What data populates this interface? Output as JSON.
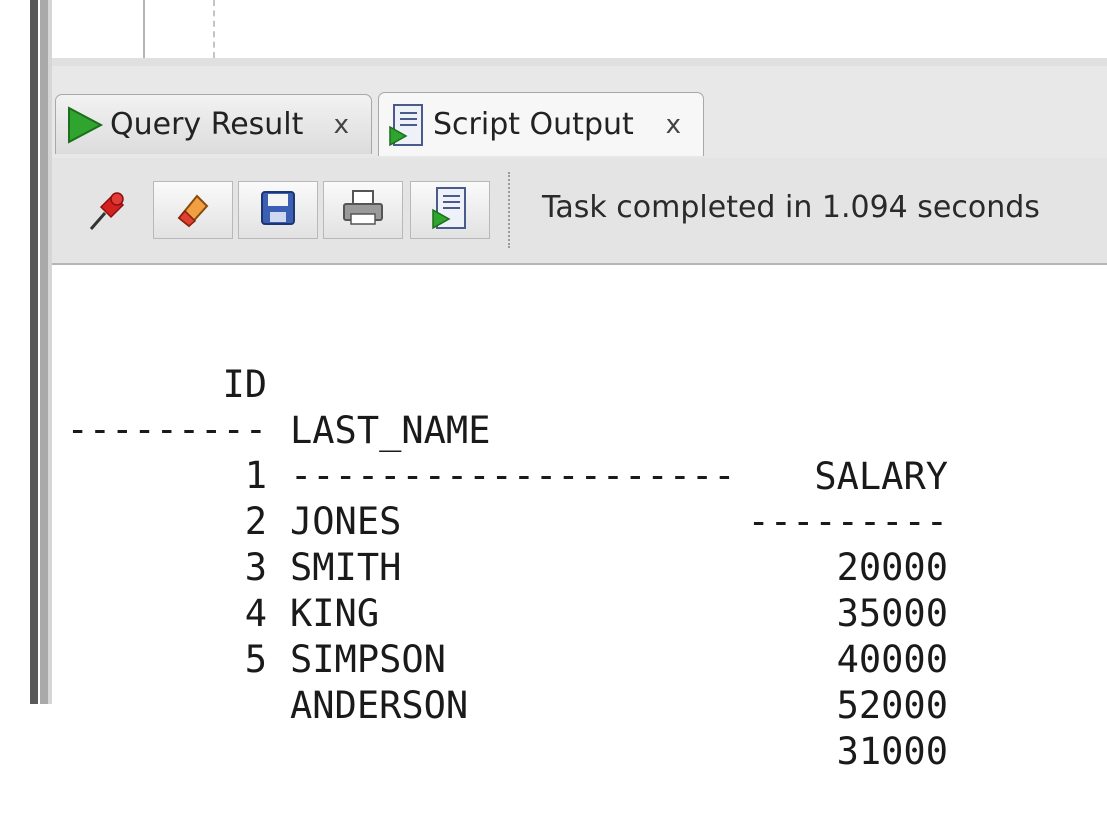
{
  "tabs": [
    {
      "label": "Query Result",
      "close": "x",
      "icon": "run-triangle-icon"
    },
    {
      "label": "Script Output",
      "close": "x",
      "icon": "script-run-icon"
    }
  ],
  "toolbar": {
    "buttons": [
      "pin-icon",
      "eraser-icon",
      "save-icon",
      "print-icon",
      "run-script-icon"
    ],
    "status": "Task completed in 1.094 seconds"
  },
  "output": {
    "columns": [
      "ID",
      "LAST_NAME",
      "SALARY"
    ],
    "separator": [
      "---------",
      "--------------------",
      "---------"
    ],
    "rows": [
      {
        "id": "1",
        "last_name": "JONES",
        "salary": "20000"
      },
      {
        "id": "2",
        "last_name": "SMITH",
        "salary": "35000"
      },
      {
        "id": "3",
        "last_name": "KING",
        "salary": "40000"
      },
      {
        "id": "4",
        "last_name": "SIMPSON",
        "salary": "52000"
      },
      {
        "id": "5",
        "last_name": "ANDERSON",
        "salary": "31000"
      }
    ]
  },
  "colors": {
    "run_green": "#2fa52f",
    "pin_red": "#d4201f",
    "save_blue": "#3b5fb5"
  }
}
